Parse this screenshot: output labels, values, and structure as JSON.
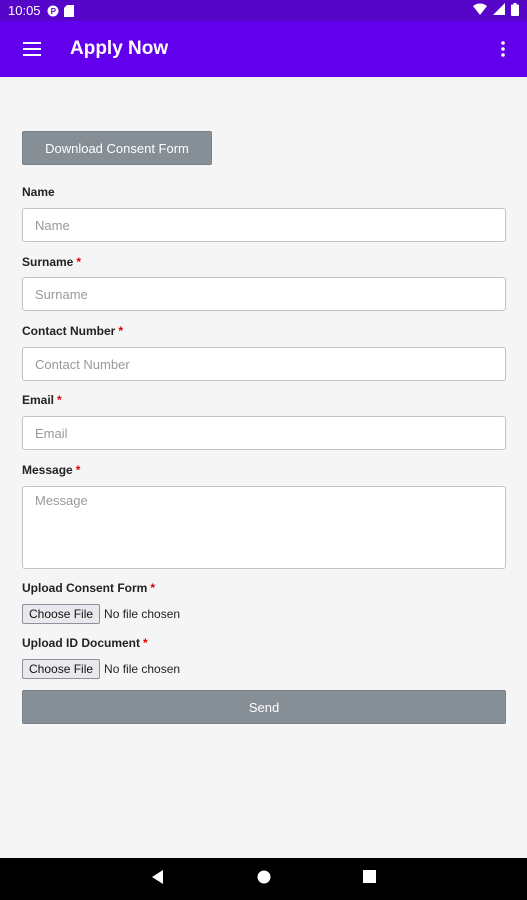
{
  "status_bar": {
    "time": "10:05",
    "icons": [
      "p-icon",
      "sd-card-icon",
      "wifi-icon",
      "signal-icon",
      "battery-icon"
    ]
  },
  "app_bar": {
    "title": "Apply Now",
    "menu_icon": "hamburger-menu-icon",
    "more_icon": "more-vert-icon"
  },
  "form": {
    "download_label": "Download Consent Form",
    "fields": [
      {
        "label": "Name",
        "required": false,
        "placeholder": "Name"
      },
      {
        "label": "Surname",
        "required": true,
        "placeholder": "Surname"
      },
      {
        "label": "Contact Number",
        "required": true,
        "placeholder": "Contact Number"
      },
      {
        "label": "Email",
        "required": true,
        "placeholder": "Email"
      },
      {
        "label": "Message",
        "required": true,
        "placeholder": "Message"
      }
    ],
    "required_marker": "*",
    "uploads": [
      {
        "label": "Upload Consent Form",
        "button": "Choose File",
        "status": "No file chosen"
      },
      {
        "label": "Upload ID Document",
        "button": "Choose File",
        "status": "No file chosen"
      }
    ],
    "send_label": "Send"
  },
  "colors": {
    "status_bar": "#5606c8",
    "app_bar": "#6200ee",
    "button": "#868e96",
    "required": "#dd0000"
  },
  "nav_bar": {
    "icons": [
      "back-icon",
      "home-icon",
      "recents-icon"
    ]
  }
}
